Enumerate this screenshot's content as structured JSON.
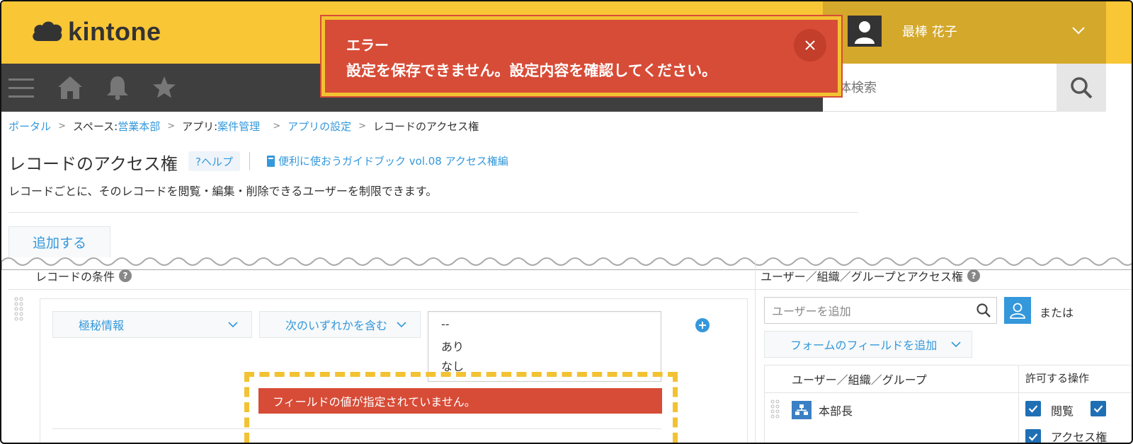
{
  "app": {
    "logo_text": "kintone",
    "user_name": "最棒 花子",
    "search_placeholder": "全体検索"
  },
  "toast": {
    "title": "エラー",
    "message": "設定を保存できません。設定内容を確認してください。"
  },
  "breadcrumb": {
    "portal": "ポータル",
    "space_prefix": "スペース: ",
    "space": "営業本部",
    "app_prefix": "アプリ: ",
    "app": "案件管理",
    "settings": "アプリの設定",
    "current": "レコードのアクセス権",
    "separator": ">"
  },
  "page": {
    "title": "レコードのアクセス権",
    "help_label": "?ヘルプ",
    "guide_label": "便利に使おうガイドブック vol.08 アクセス権編",
    "description": "レコードごとに、そのレコードを閲覧・編集・削除できるユーザーを制限できます。",
    "add_button": "追加する"
  },
  "conditions": {
    "header": "レコードの条件",
    "field_select": "極秘情報",
    "operator_select": "次のいずれかを含む",
    "options": [
      "--",
      "あり",
      "なし"
    ],
    "error_text": "フィールドの値が指定されていません。"
  },
  "permissions": {
    "header": "ユーザー／組織／グループとアクセス権",
    "user_input_placeholder": "ユーザーを追加",
    "or_text": "または",
    "field_button": "フォームのフィールドを追加",
    "col_entity": "ユーザー／組織／グループ",
    "col_actions": "許可する操作",
    "rows": [
      {
        "name": "本部長",
        "view_label": "閲覧",
        "access_label": "アクセス権"
      }
    ]
  },
  "colors": {
    "header_yellow": "#f9c635",
    "header_dark": "#3f3f3f",
    "error_red": "#d74c37",
    "link_blue": "#3498db",
    "dash_yellow": "#f2c232"
  }
}
